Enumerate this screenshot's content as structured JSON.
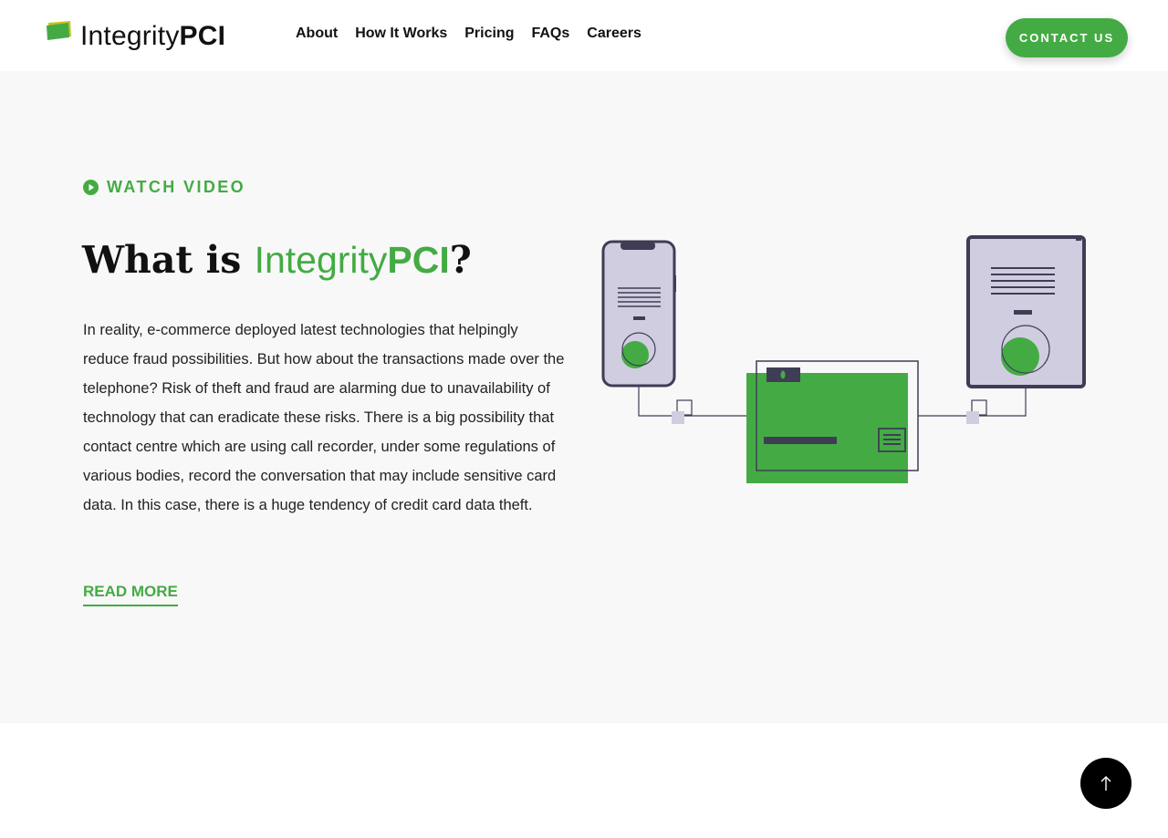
{
  "brand": {
    "name_light": "Integrity",
    "name_bold": "PCI",
    "accent": "#44ab44",
    "dark": "#3f3d56",
    "light_purple": "#d0cde1"
  },
  "nav": {
    "items": [
      "About",
      "How It Works",
      "Pricing",
      "FAQs",
      "Careers"
    ]
  },
  "header": {
    "contact_label": "CONTACT US"
  },
  "hero": {
    "watch_label": "WATCH VIDEO",
    "title_prefix": "What is ",
    "title_brand_light": "Integrity",
    "title_brand_bold": "PCI",
    "title_suffix": "?",
    "paragraph": "In reality, e-commerce deployed latest technologies that helpingly reduce fraud possibilities. But how about the transactions made over the telephone? Risk of theft and fraud are alarming due to unavailability of technology that can eradicate these risks. There is a big possibility that contact centre which are using call recorder, under some regulations of various bodies, record the conversation that may include sensitive card data. In this case, there is a huge tendency of credit card data theft.",
    "read_more_label": "READ MORE"
  },
  "icons": {
    "logo": "card-logo-icon",
    "watch": "play-circle-icon",
    "scroll_top": "arrow-up-icon",
    "illustration": "phone-card-tablet-illustration"
  }
}
